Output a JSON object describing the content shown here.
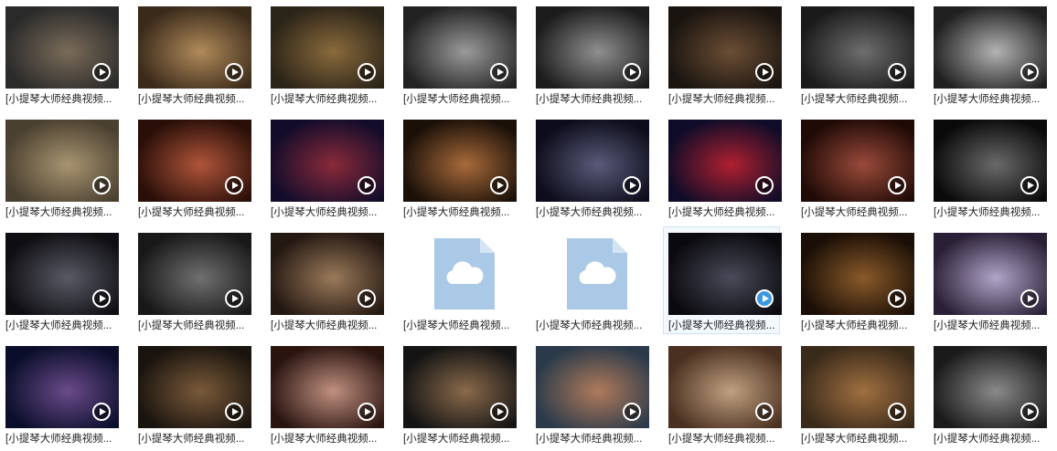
{
  "colors": {
    "selected_border": "#cde4f7",
    "selected_bg": "#f3f9ff",
    "file_icon": "#a9c9e6",
    "play_active": "#3b99e4"
  },
  "tiles": [
    {
      "label": "[小提琴大师经典视频...",
      "kind": "video",
      "bg": [
        "#2a2a2a",
        "#7a6b58"
      ]
    },
    {
      "label": "[小提琴大师经典视频...",
      "kind": "video",
      "bg": [
        "#3a2a1a",
        "#b08a5a"
      ]
    },
    {
      "label": "[小提琴大师经典视频...",
      "kind": "video",
      "bg": [
        "#2b2418",
        "#8a6a3c"
      ]
    },
    {
      "label": "[小提琴大师经典视频...",
      "kind": "video",
      "bg": [
        "#222222",
        "#9a9a9a"
      ]
    },
    {
      "label": "[小提琴大师经典视频...",
      "kind": "video",
      "bg": [
        "#1c1c1c",
        "#8f8f8f"
      ]
    },
    {
      "label": "[小提琴大师经典视频...",
      "kind": "video",
      "bg": [
        "#1a1410",
        "#6b4e34"
      ]
    },
    {
      "label": "[小提琴大师经典视频...",
      "kind": "video",
      "bg": [
        "#1a1a1a",
        "#6e6e6e"
      ]
    },
    {
      "label": "[小提琴大师经典视频...",
      "kind": "video",
      "bg": [
        "#202020",
        "#b3b3b3"
      ]
    },
    {
      "label": "[小提琴大师经典视频...",
      "kind": "video",
      "bg": [
        "#4a4030",
        "#a89470"
      ]
    },
    {
      "label": "[小提琴大师经典视频...",
      "kind": "video",
      "bg": [
        "#2a0f08",
        "#b0553a"
      ]
    },
    {
      "label": "[小提琴大师经典视频...",
      "kind": "video",
      "bg": [
        "#120c2a",
        "#8a2a3a"
      ]
    },
    {
      "label": "[小提琴大师经典视频...",
      "kind": "video",
      "bg": [
        "#1a1008",
        "#a86a3a"
      ]
    },
    {
      "label": "[小提琴大师经典视频...",
      "kind": "video",
      "bg": [
        "#0c0c1a",
        "#5a5a7a"
      ]
    },
    {
      "label": "[小提琴大师经典视频...",
      "kind": "video",
      "bg": [
        "#0e0c28",
        "#b02030"
      ]
    },
    {
      "label": "[小提琴大师经典视频...",
      "kind": "video",
      "bg": [
        "#200a06",
        "#9a4a3a"
      ]
    },
    {
      "label": "[小提琴大师经典视频...",
      "kind": "video",
      "bg": [
        "#0a0a0a",
        "#6a6a6a"
      ]
    },
    {
      "label": "[小提琴大师经典视频...",
      "kind": "video",
      "bg": [
        "#0e0e12",
        "#5a5a66"
      ]
    },
    {
      "label": "[小提琴大师经典视频...",
      "kind": "video",
      "bg": [
        "#181818",
        "#707070"
      ]
    },
    {
      "label": "[小提琴大师经典视频...",
      "kind": "video",
      "bg": [
        "#241812",
        "#9a7a5a"
      ]
    },
    {
      "label": "[小提琴大师经典视频...",
      "kind": "file",
      "bg": [
        "#ffffff",
        "#ffffff"
      ]
    },
    {
      "label": "[小提琴大师经典视频...",
      "kind": "file",
      "bg": [
        "#ffffff",
        "#ffffff"
      ]
    },
    {
      "label": "[小提琴大师经典视频...",
      "kind": "video",
      "bg": [
        "#0a0a0e",
        "#4a4a5a"
      ],
      "selected": true
    },
    {
      "label": "[小提琴大师经典视频...",
      "kind": "video",
      "bg": [
        "#1a0e06",
        "#8a5a2a"
      ]
    },
    {
      "label": "[小提琴大师经典视频...",
      "kind": "video",
      "bg": [
        "#2a2036",
        "#b0a4c8"
      ]
    },
    {
      "label": "[小提琴大师经典视频...",
      "kind": "video",
      "bg": [
        "#0a0e2a",
        "#6a4a8a"
      ]
    },
    {
      "label": "[小提琴大师经典视频...",
      "kind": "video",
      "bg": [
        "#1a140e",
        "#7a5a3a"
      ]
    },
    {
      "label": "[小提琴大师经典视频...",
      "kind": "video",
      "bg": [
        "#2a1410",
        "#c09080"
      ]
    },
    {
      "label": "[小提琴大师经典视频...",
      "kind": "video",
      "bg": [
        "#141414",
        "#8a6a4a"
      ]
    },
    {
      "label": "[小提琴大师经典视频...",
      "kind": "video",
      "bg": [
        "#2a3a4a",
        "#b07a5a"
      ]
    },
    {
      "label": "[小提琴大师经典视频...",
      "kind": "video",
      "bg": [
        "#4a3020",
        "#c0a080"
      ]
    },
    {
      "label": "[小提琴大师经典视频...",
      "kind": "video",
      "bg": [
        "#3a2a1a",
        "#a07040"
      ]
    },
    {
      "label": "[小提琴大师经典视频...",
      "kind": "video",
      "bg": [
        "#1a1a1a",
        "#8a8a8a"
      ]
    }
  ]
}
